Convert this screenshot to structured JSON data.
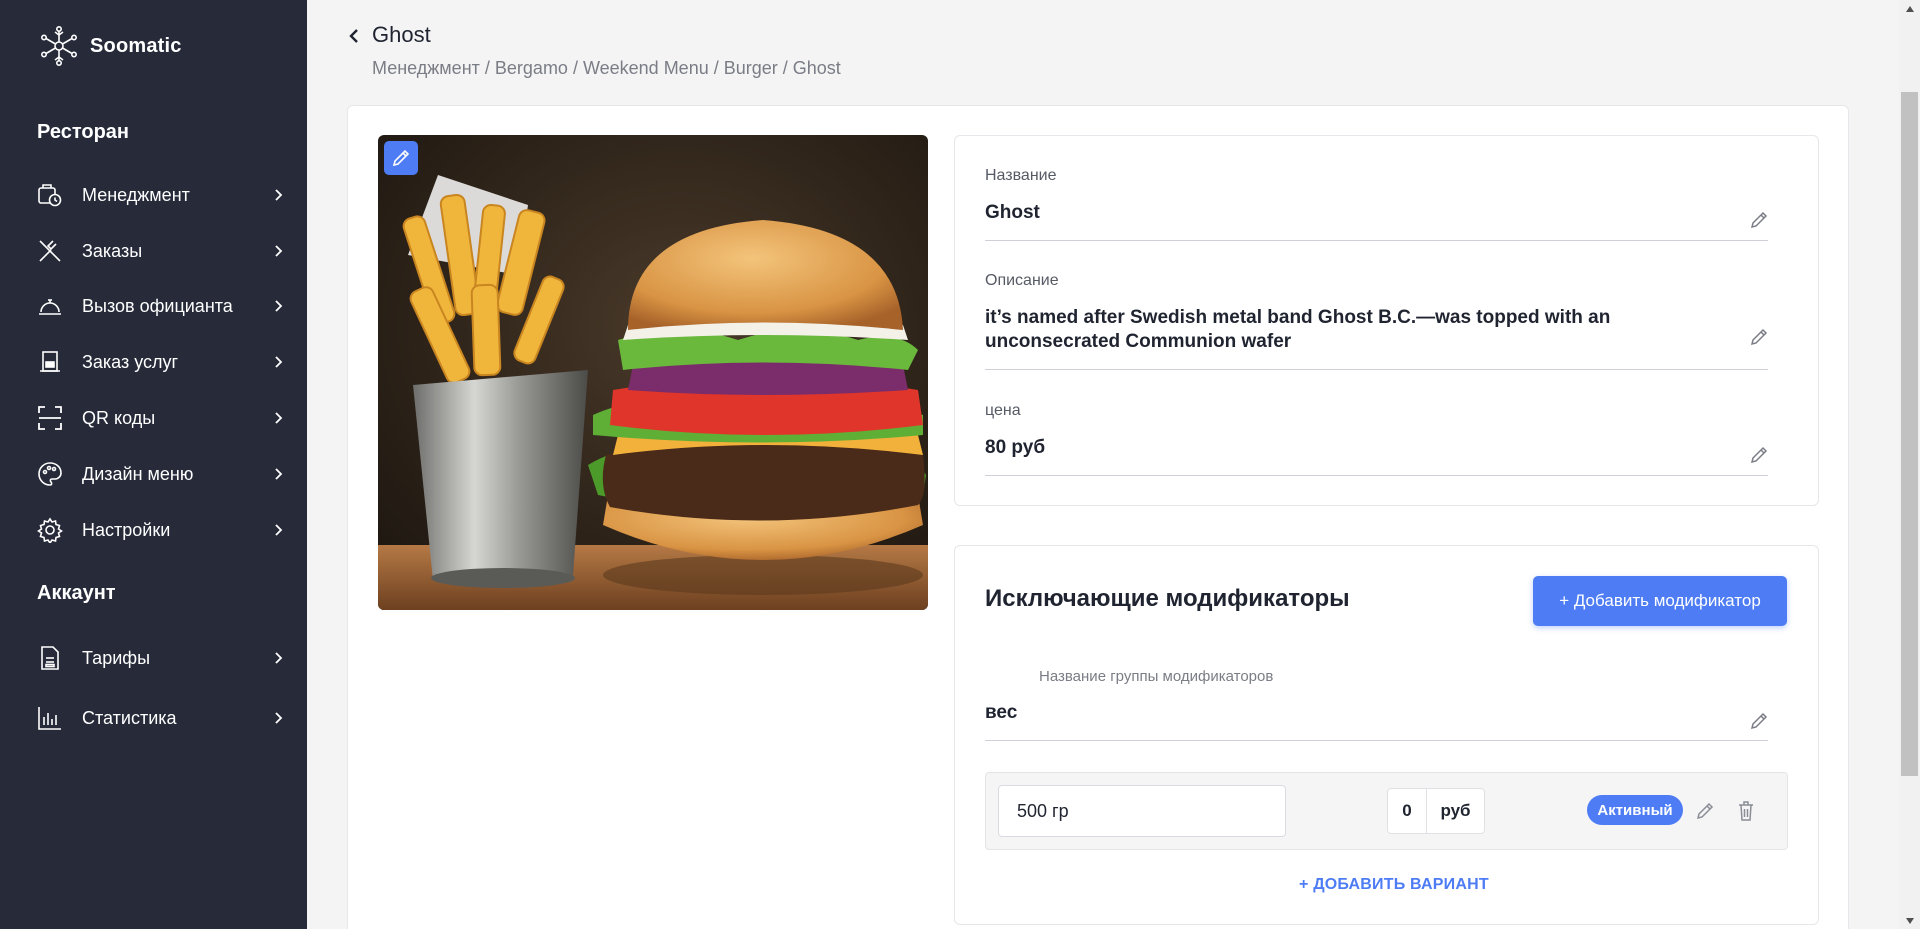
{
  "brand": {
    "name": "Soomatic",
    "logo_icon": "network-snowflake-icon"
  },
  "sidebar": {
    "section_restaurant": "Ресторан",
    "restaurant_items": [
      {
        "label": "Менеджмент",
        "icon": "management-icon"
      },
      {
        "label": "Заказы",
        "icon": "cutlery-icon"
      },
      {
        "label": "Вызов официанта",
        "icon": "service-bell-icon"
      },
      {
        "label": "Заказ услуг",
        "icon": "door-icon"
      },
      {
        "label": "QR коды",
        "icon": "qr-scan-icon"
      },
      {
        "label": "Дизайн меню",
        "icon": "palette-icon"
      },
      {
        "label": "Настройки",
        "icon": "gear-icon"
      }
    ],
    "section_account": "Аккаунт",
    "account_items": [
      {
        "label": "Тарифы",
        "icon": "document-icon"
      },
      {
        "label": "Статистика",
        "icon": "bar-chart-icon"
      }
    ]
  },
  "header": {
    "title": "Ghost",
    "breadcrumb": [
      "Менеджмент",
      "Bergamo",
      "Weekend Menu",
      "Burger",
      "Ghost"
    ],
    "breadcrumb_separator": " / "
  },
  "item": {
    "photo_alt": "Burger with fries",
    "name_label": "Название",
    "name_value": "Ghost",
    "description_label": "Описание",
    "description_value": "it’s named after Swedish metal band Ghost B.C.—was topped with an unconsecrated Communion wafer",
    "price_label": "цена",
    "price_value": "80 руб"
  },
  "modifiers": {
    "title": "Исключающие модификаторы",
    "add_button": "+ Добавить модификатор",
    "group_label": "Название группы модификаторов",
    "group_value": "вес",
    "variants": [
      {
        "name": "500 гр",
        "price": "0",
        "currency": "руб",
        "status": "Активный"
      }
    ],
    "add_variant": "+ ДОБАВИТЬ ВАРИАНТ"
  },
  "colors": {
    "sidebar_bg": "#262a39",
    "accent": "#4d7cf5",
    "page_bg": "#f4f4f5"
  }
}
